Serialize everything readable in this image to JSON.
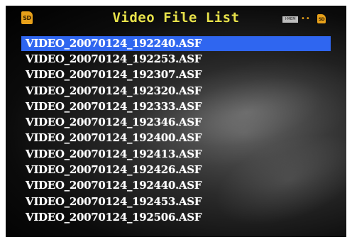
{
  "header": {
    "title": "Video File List",
    "left_icon": {
      "name": "sd-card-icon",
      "label": "SD"
    },
    "right_icons": [
      {
        "name": "internal-memory-icon",
        "label": "I-MEM"
      },
      {
        "name": "transfer-arrows-icon",
        "label": "••"
      },
      {
        "name": "sd-card-icon",
        "label": "SD"
      }
    ]
  },
  "files": [
    "VIDEO_20070124_192240.ASF",
    "VIDEO_20070124_192253.ASF",
    "VIDEO_20070124_192307.ASF",
    "VIDEO_20070124_192320.ASF",
    "VIDEO_20070124_192333.ASF",
    "VIDEO_20070124_192346.ASF",
    "VIDEO_20070124_192400.ASF",
    "VIDEO_20070124_192413.ASF",
    "VIDEO_20070124_192426.ASF",
    "VIDEO_20070124_192440.ASF",
    "VIDEO_20070124_192453.ASF",
    "VIDEO_20070124_192506.ASF"
  ],
  "selected_index": 0,
  "colors": {
    "selection": "#2f66f0",
    "title": "#e8e24a",
    "icon_accent": "#e8a11a"
  }
}
